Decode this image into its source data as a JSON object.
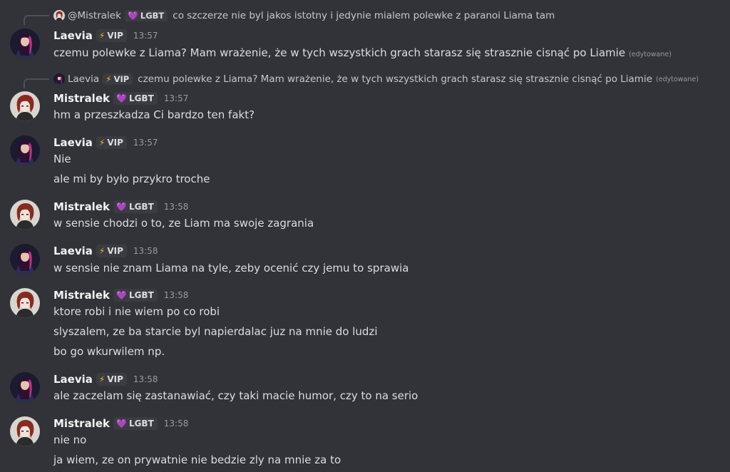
{
  "colors": {
    "background": "#313338",
    "username": "#f2f3f5",
    "text": "#dbdee1",
    "muted": "#949ba4",
    "vip_icon": "#f0b232",
    "lgbt_icon": "#d47ad6"
  },
  "badges": {
    "vip_icon": "⚡",
    "vip_label": "VIP",
    "lgbt_icon": "💜",
    "lgbt_label": "LGBT"
  },
  "edited_label": "(edytowane)",
  "messages": [
    {
      "reply": {
        "author": "@Mistralek",
        "badge_label": "LGBT",
        "text": "co szczerze nie byl jakos istotny i jedynie mialem polewke z paranoi Liama tam"
      },
      "author": "Laevia",
      "badge_label": "VIP",
      "time": "13:57",
      "lines": [
        "czemu polewke z Liama? Mam wrażenie, że w tych wszystkich grach starasz się strasznie cisnąć po Liamie"
      ]
    },
    {
      "reply": {
        "author": "Laevia",
        "badge_label": "VIP",
        "text": "czemu polewke z Liama? Mam wrażenie, że w tych wszystkich grach starasz się strasznie cisnąć po Liamie"
      },
      "author": "Mistralek",
      "badge_label": "LGBT",
      "time": "13:57",
      "lines": [
        "hm a przeszkadza Ci bardzo ten fakt?"
      ]
    },
    {
      "author": "Laevia",
      "badge_label": "VIP",
      "time": "13:57",
      "lines": [
        "Nie",
        "ale mi by było przykro troche"
      ]
    },
    {
      "author": "Mistralek",
      "badge_label": "LGBT",
      "time": "13:58",
      "lines": [
        "w sensie chodzi o to, ze Liam ma swoje zagrania"
      ]
    },
    {
      "author": "Laevia",
      "badge_label": "VIP",
      "time": "13:58",
      "lines": [
        "w sensie nie znam Liama na tyle, zeby ocenić czy jemu to sprawia"
      ]
    },
    {
      "author": "Mistralek",
      "badge_label": "LGBT",
      "time": "13:58",
      "lines": [
        "ktore robi i nie wiem po co robi",
        "slyszalem, ze ba starcie byl napierdalac juz na mnie do ludzi",
        "bo go wkurwilem np."
      ]
    },
    {
      "author": "Laevia",
      "badge_label": "VIP",
      "time": "13:58",
      "lines": [
        "ale zaczelam się zastanawiać, czy taki macie humor, czy to na serio"
      ]
    },
    {
      "author": "Mistralek",
      "badge_label": "LGBT",
      "time": "13:58",
      "lines": [
        "nie no",
        "ja wiem, ze on prywatnie nie bedzie zly na mnie za to"
      ]
    }
  ]
}
